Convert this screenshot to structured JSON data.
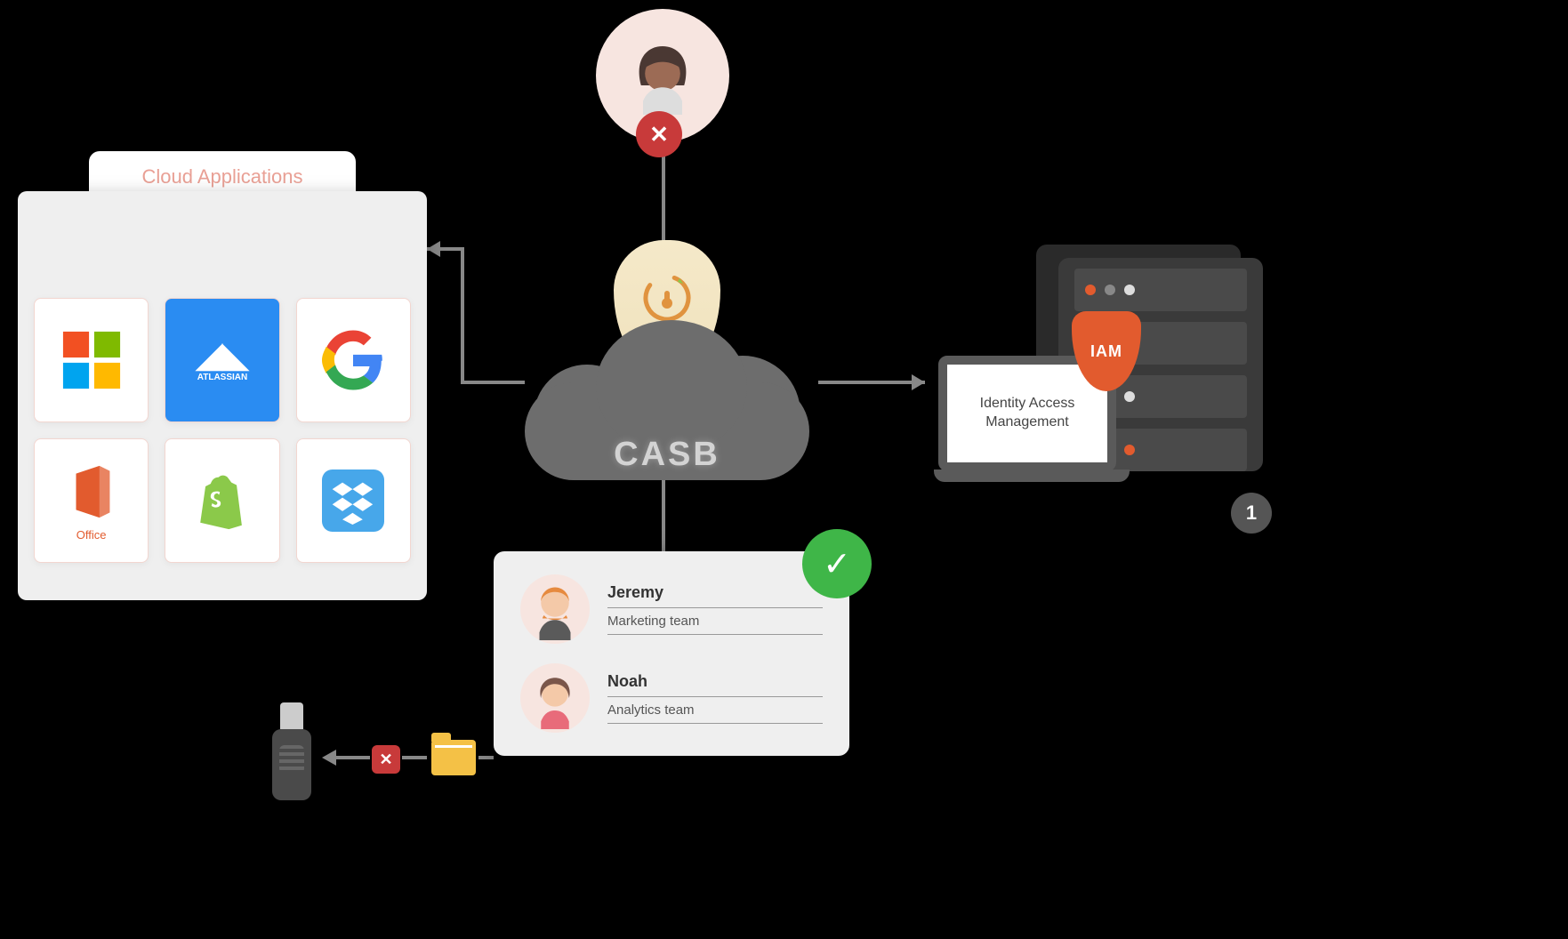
{
  "cloud_apps": {
    "title": "Cloud Applications",
    "apps": [
      "Microsoft",
      "Atlassian",
      "Google",
      "Office",
      "Shopify",
      "Dropbox"
    ],
    "atlassian_label": "ATLASSIAN",
    "office_label": "Office"
  },
  "center": {
    "label": "CASB"
  },
  "top_user": {
    "status": "denied",
    "status_icon": "✕"
  },
  "iam": {
    "panel_text": "Identity Access Management",
    "badge": "IAM",
    "step": "1"
  },
  "users": {
    "status_icon": "✓",
    "list": [
      {
        "name": "Jeremy",
        "team": "Marketing team"
      },
      {
        "name": "Noah",
        "team": "Analytics team"
      }
    ]
  },
  "usb_block": {
    "icon": "✕"
  }
}
